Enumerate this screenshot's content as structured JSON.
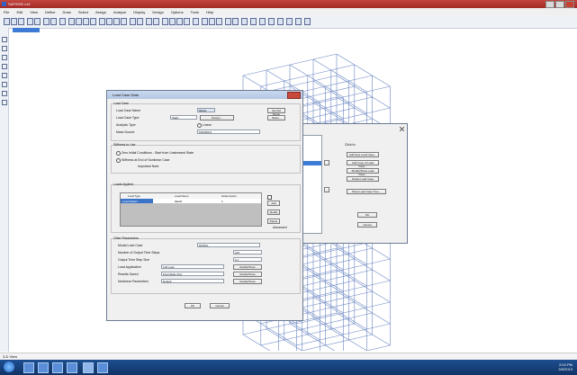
{
  "app": {
    "title": "SAP2000 v14",
    "menu": [
      "File",
      "Edit",
      "View",
      "Define",
      "Draw",
      "Select",
      "Assign",
      "Analyze",
      "Display",
      "Design",
      "Options",
      "Tools",
      "Help"
    ]
  },
  "status": {
    "text": "3-D View",
    "clock_time": "2:04 PM",
    "clock_date": "3/5/2013"
  },
  "load_case_dialog": {
    "title": "Load Case Data",
    "load_case_name_group": "Load Case",
    "name_label": "Load Case Name",
    "name_value": "DEAD",
    "set_def_name": "Set Def Name",
    "load_case_type_label": "Load Case Type",
    "load_case_type_value": "Static",
    "design_button": "Design...",
    "modify_show": "Modify/Show",
    "notes_button": "Notes...",
    "analysis_type_label": "Analysis Type",
    "analysis_type_value": "Linear",
    "mass_source_label": "Mass Source",
    "mass_source_value": "MSSSRC1",
    "stiffness_group": "Stiffness to Use",
    "zero_initial": "Zero Initial Conditions - Start from Unstressed State",
    "stiffness_end": "Stiffness at End of Nonlinear Case",
    "important_note": "Important Note:",
    "loads_group": "Loads Applied",
    "col_load_type": "Load Type",
    "col_load_name": "Load Name",
    "col_scale_factor": "Scale Factor",
    "row_load_type": "Load Pattern",
    "row_load_name": "DEAD",
    "row_scale_factor": "1.",
    "add_button": "Add",
    "modify_button": "Modify",
    "delete_button": "Delete",
    "advanced_label": "Advanced",
    "other_params_group": "Other Parameters",
    "modal_load_case_label": "Modal Load Case",
    "modal_load_case_value": "MODAL",
    "number_outputs_label": "Number of Output Time Steps",
    "number_outputs_value": "100",
    "time_step_label": "Output Time Step Size",
    "time_step_value": "0.1",
    "load_application_label": "Load Application",
    "load_application_value": "Full Load",
    "results_saved_label": "Results Saved",
    "results_saved_value": "Final State Only",
    "nonlinear_label": "Nonlinear Parameters",
    "nonlinear_value": "Default",
    "ok_button": "OK",
    "cancel_button": "Cancel"
  },
  "define_cases_dialog": {
    "title": "Define Load Cases",
    "click_to_label": "Click to:",
    "add_new": "Add New Load Case...",
    "add_copy": "Add Copy of Load Case...",
    "modify_show": "Modify/Show Load Case...",
    "delete": "Delete Load Case",
    "display_tree": "Show Load Case Tree...",
    "ok_button": "OK",
    "cancel_button": "Cancel"
  }
}
